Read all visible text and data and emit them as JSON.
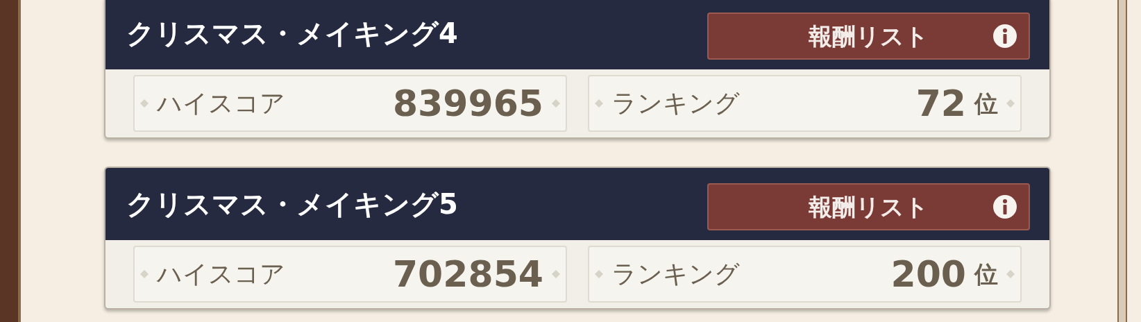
{
  "events": [
    {
      "title": "クリスマス・メイキング4",
      "reward_button": "報酬リスト",
      "high_score_label": "ハイスコア",
      "high_score": "839965",
      "ranking_label": "ランキング",
      "rank": "72",
      "rank_unit": "位"
    },
    {
      "title": "クリスマス・メイキング5",
      "reward_button": "報酬リスト",
      "high_score_label": "ハイスコア",
      "high_score": "702854",
      "ranking_label": "ランキング",
      "rank": "200",
      "rank_unit": "位"
    }
  ]
}
